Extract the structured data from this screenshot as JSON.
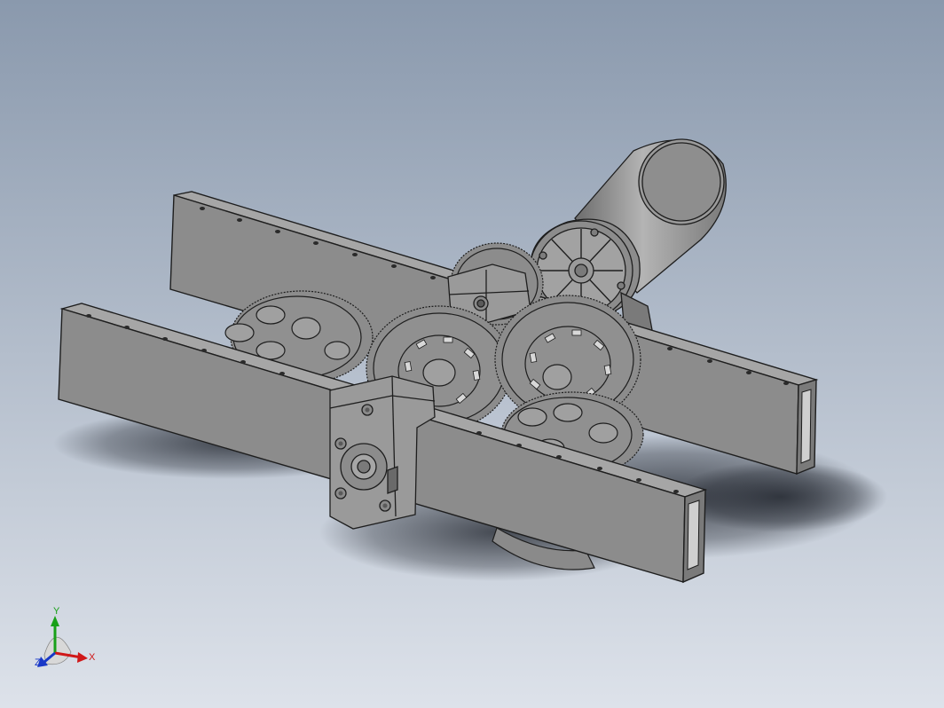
{
  "viewport": {
    "background_top": "#8a99ad",
    "background_bottom": "#dde2ea",
    "part_color": "#8c8c8c",
    "edge_color": "#1e1e1e"
  },
  "triad": {
    "x_label": "X",
    "y_label": "Y",
    "z_label": "Z",
    "x_color": "#d01818",
    "y_color": "#18a018",
    "z_color": "#1838c8"
  }
}
